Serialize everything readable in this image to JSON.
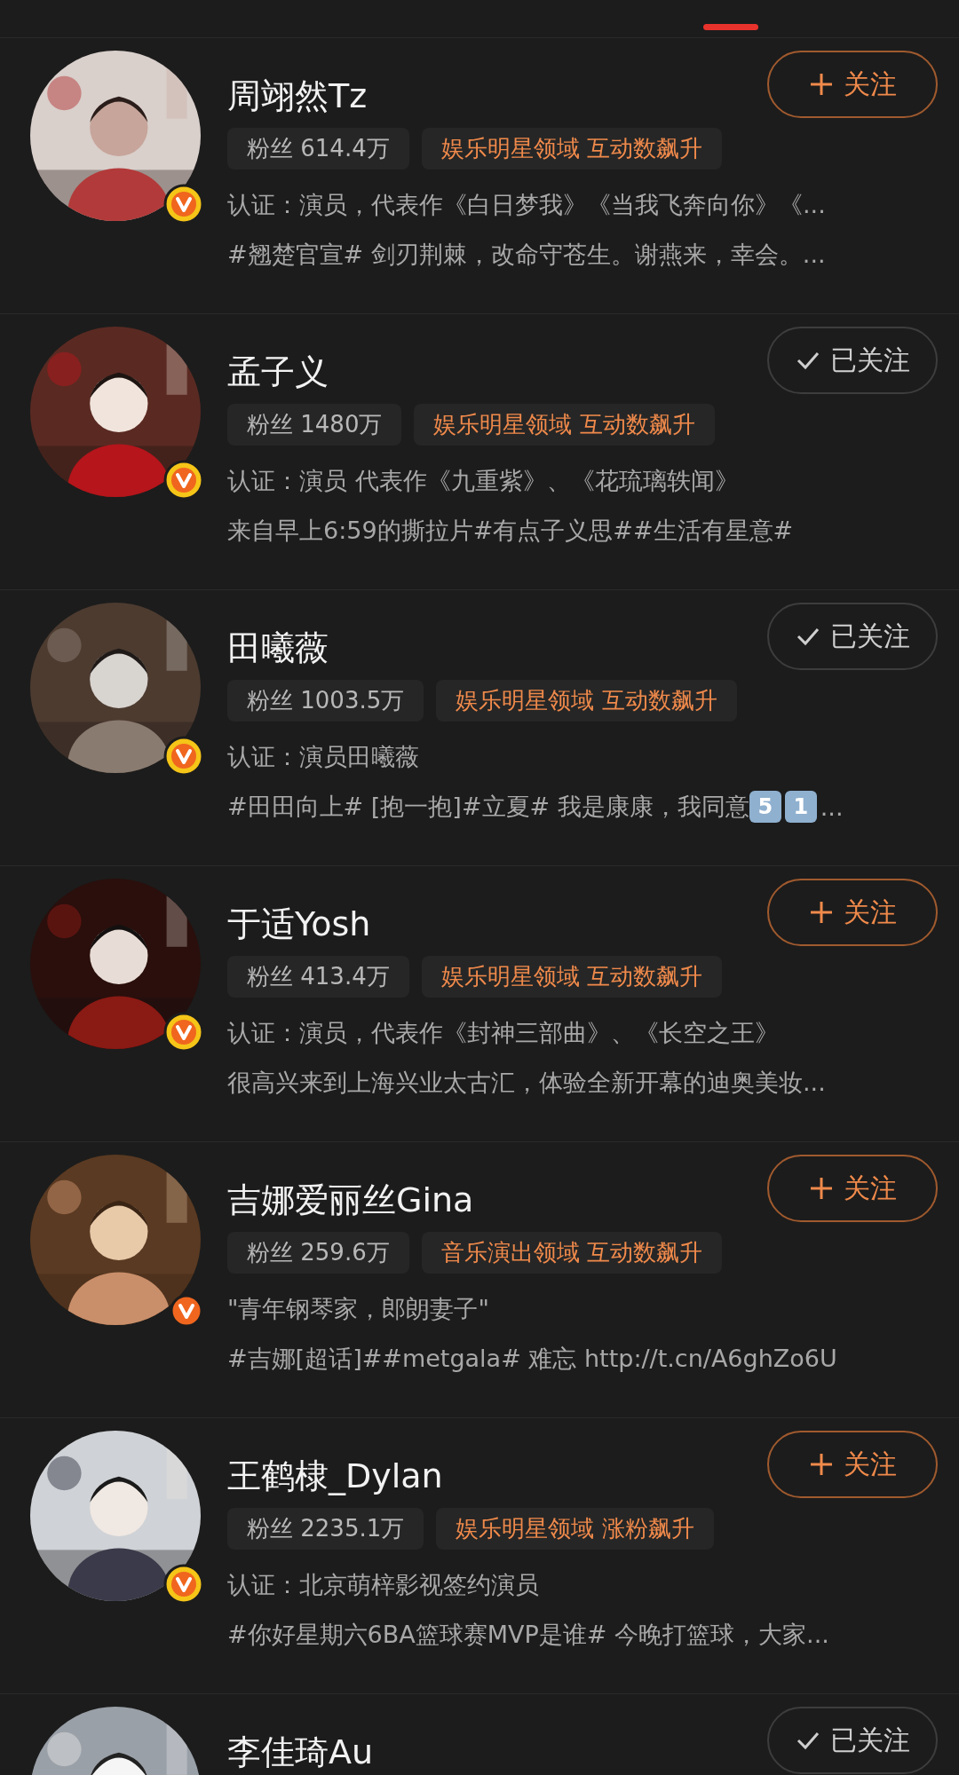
{
  "users": [
    {
      "name": "周翊然Tz",
      "verified": true,
      "color": "#f5c518",
      "followed": false,
      "button": "关注",
      "fans": "粉丝 614.4万",
      "tag": "娱乐明星领域 互动数飙升",
      "bio": "认证：演员，代表作《白日梦我》《当我飞奔向你》《...",
      "post": [
        {
          "kind": "text",
          "text": "#翘楚官宣# 剑刃荆棘，改命守苍生。谢燕来，幸会。..."
        }
      ]
    },
    {
      "name": "孟子义",
      "verified": true,
      "color": "#f5c518",
      "followed": true,
      "button": "已关注",
      "fans": "粉丝 1480万",
      "tag": "娱乐明星领域 互动数飙升",
      "bio": "认证：演员 代表作《九重紫》、《花琉璃轶闻》",
      "post": [
        {
          "kind": "text",
          "text": "来自早上6:59的撕拉片#有点子义思##生活有星意#"
        }
      ]
    },
    {
      "name": "田曦薇",
      "verified": true,
      "color": "#f5c518",
      "followed": true,
      "button": "已关注",
      "fans": "粉丝 1003.5万",
      "tag": "娱乐明星领域 互动数飙升",
      "bio": "认证：演员田曦薇",
      "post": [
        {
          "kind": "text",
          "text": "#田田向上# [抱一抱]#立夏# 我是康康，我同意"
        },
        {
          "kind": "keycap",
          "text": "5"
        },
        {
          "kind": "keycap",
          "text": "1"
        },
        {
          "kind": "text",
          "text": "..."
        }
      ]
    },
    {
      "name": "于适Yosh",
      "verified": true,
      "color": "#f5c518",
      "followed": false,
      "button": "关注",
      "fans": "粉丝 413.4万",
      "tag": "娱乐明星领域 互动数飙升",
      "bio": "认证：演员，代表作《封神三部曲》、《长空之王》",
      "post": [
        {
          "kind": "text",
          "text": "很高兴来到上海兴业太古汇，体验全新开幕的迪奥美妆..."
        }
      ]
    },
    {
      "name": "吉娜爱丽丝Gina",
      "verified": true,
      "color": "#f0661e",
      "followed": false,
      "button": "关注",
      "fans": "粉丝 259.6万",
      "tag": "音乐演出领域 互动数飙升",
      "bio": "\"青年钢琴家，郎朗妻子\"",
      "post": [
        {
          "kind": "text",
          "text": "#吉娜[超话]##metgala# 难忘 http://t.cn/A6ghZo6U"
        }
      ]
    },
    {
      "name": "王鹤棣_Dylan",
      "verified": true,
      "color": "#f5c518",
      "followed": false,
      "button": "关注",
      "fans": "粉丝 2235.1万",
      "tag": "娱乐明星领域 涨粉飙升",
      "bio": "认证：北京萌梓影视签约演员",
      "post": [
        {
          "kind": "text",
          "text": "#你好星期六6BA篮球赛MVP是谁# 今晚打篮球，大家..."
        }
      ]
    },
    {
      "name": "李佳琦Au",
      "followed": true,
      "button": "已关注"
    }
  ]
}
